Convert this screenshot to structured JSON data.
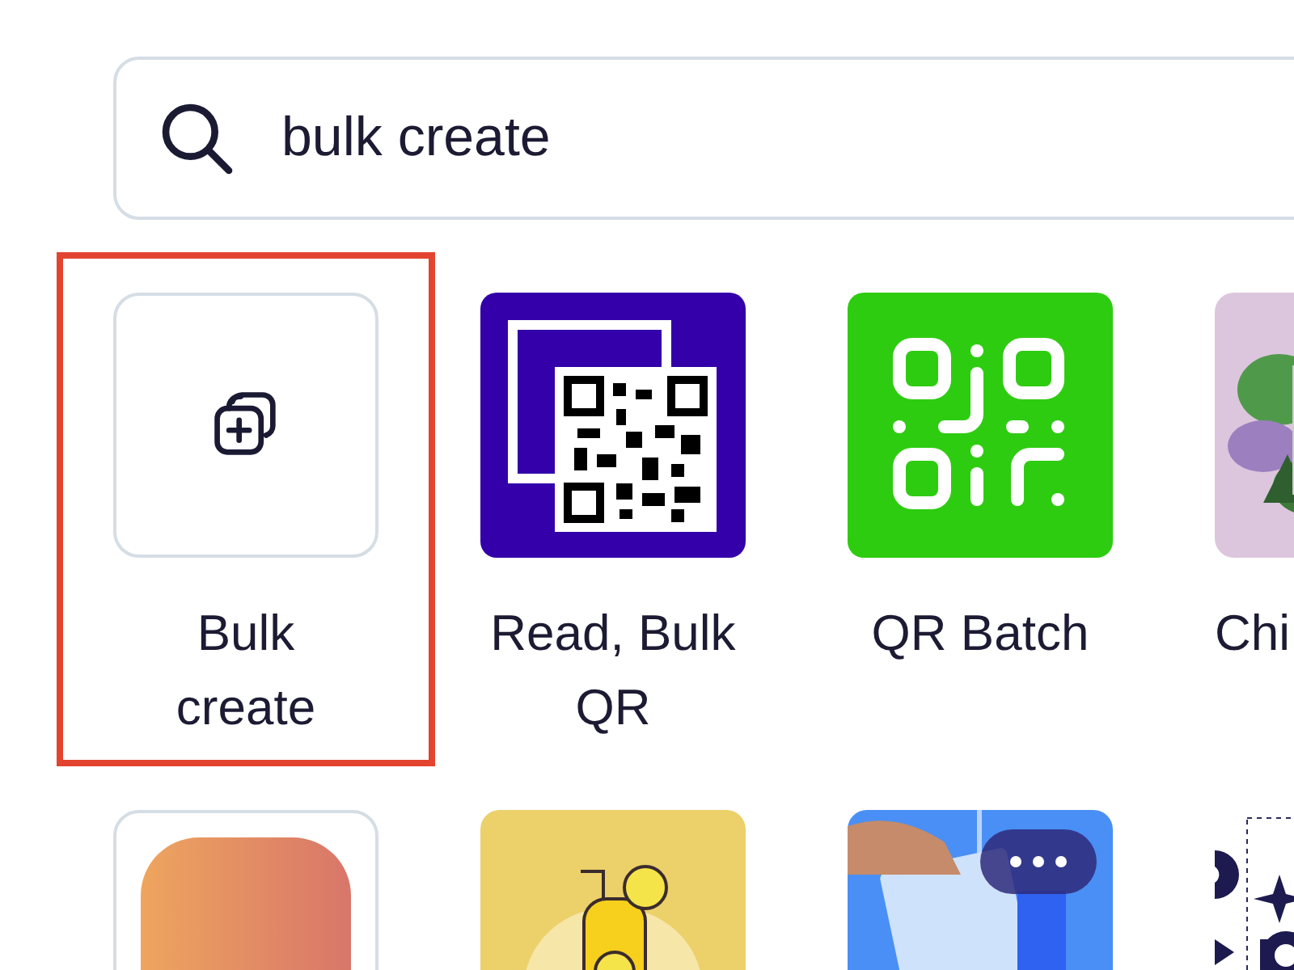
{
  "search": {
    "value": "bulk create"
  },
  "rows": [
    {
      "tiles": [
        {
          "kind": "action",
          "label": "Bulk create",
          "highlighted": true,
          "menu": false,
          "cut": false
        },
        {
          "kind": "qr-frame",
          "label": "Read, Bulk QR",
          "highlighted": false,
          "menu": false,
          "cut": false
        },
        {
          "kind": "qr-green",
          "label": "QR Batch",
          "highlighted": false,
          "menu": false,
          "cut": false
        },
        {
          "kind": "picture",
          "label": "Chi",
          "highlighted": false,
          "menu": false,
          "cut": true
        }
      ]
    },
    {
      "tiles": [
        {
          "kind": "gradient",
          "highlighted": false,
          "menu": false
        },
        {
          "kind": "picture",
          "highlighted": false,
          "menu": false
        },
        {
          "kind": "picture",
          "highlighted": false,
          "menu": true
        },
        {
          "kind": "picture",
          "highlighted": false,
          "menu": false
        }
      ]
    }
  ]
}
